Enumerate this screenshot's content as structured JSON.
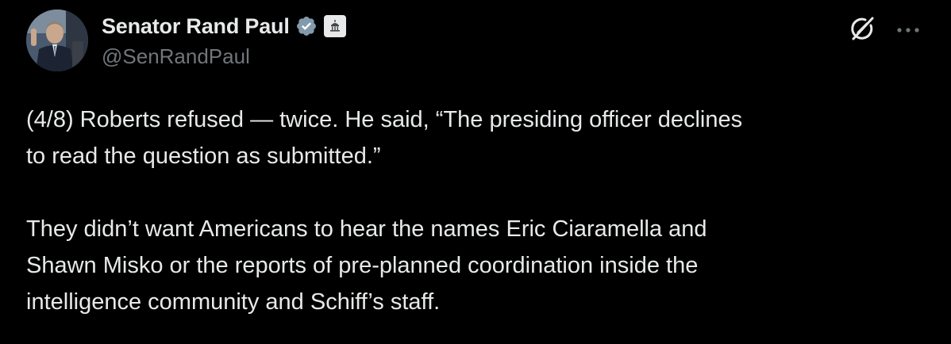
{
  "author": {
    "display_name": "Senator Rand Paul",
    "handle": "@SenRandPaul",
    "verified_icon": "verified-badge-icon",
    "affiliation_icon": "government-building-icon"
  },
  "actions": {
    "grok_icon": "grok-icon",
    "more_icon": "more-options-icon"
  },
  "tweet": {
    "paragraph1": [
      "(4/8) Roberts refused — twice. He said, “The presiding officer declines",
      "to read the question as submitted.”"
    ],
    "paragraph2": [
      "They didn’t want Americans to hear the names Eric Ciaramella and",
      "Shawn Misko or the reports of pre-planned coordination inside the",
      "intelligence community and Schiff’s staff."
    ]
  },
  "colors": {
    "background": "#000000",
    "text": "#e7e9ea",
    "secondary_text": "#71767b",
    "verified_fill": "#829aab"
  }
}
